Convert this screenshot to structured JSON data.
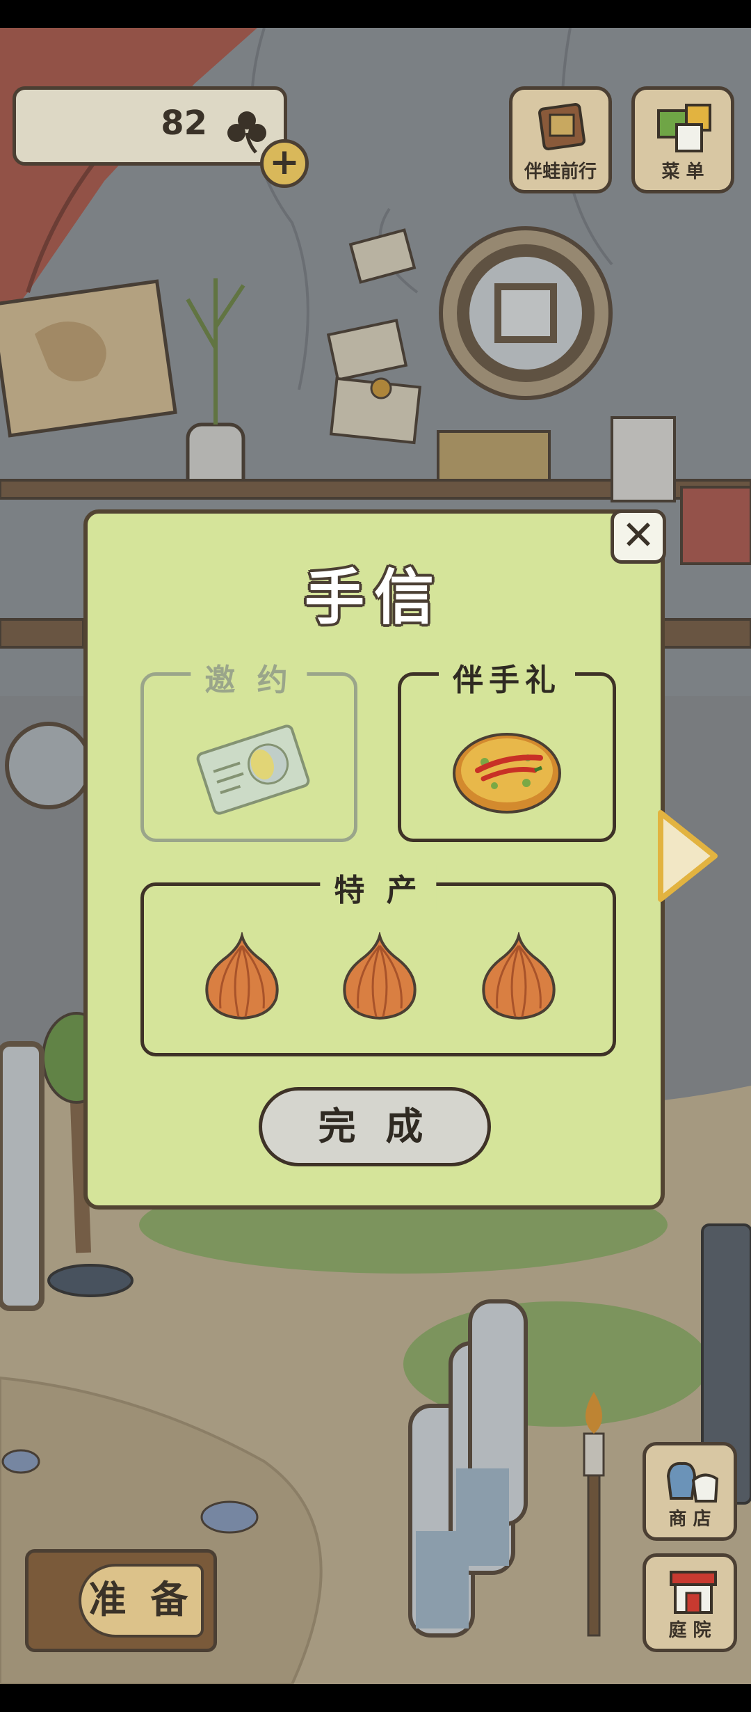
{
  "hud": {
    "clover_count": "82",
    "top_buttons": [
      {
        "label": "伴蛙前行",
        "icon": "book-icon"
      },
      {
        "label": "菜 单",
        "icon": "cards-menu-icon"
      }
    ]
  },
  "dialog": {
    "title": "手信",
    "slots": {
      "invite": {
        "label": "邀 约",
        "state": "disabled",
        "icon": "invitation-card-icon"
      },
      "gift": {
        "label": "伴手礼",
        "item": "pancake-with-chili-icon"
      },
      "specialty": {
        "label": "特 产",
        "items": [
          "onion-icon",
          "onion-icon",
          "onion-icon"
        ]
      }
    },
    "done_label": "完 成"
  },
  "bottom": {
    "prepare_label": "准 备",
    "side_buttons": [
      {
        "label": "商 店",
        "icon": "shop-icon"
      },
      {
        "label": "庭 院",
        "icon": "yard-icon"
      }
    ]
  },
  "colors": {
    "dialog_bg": "#d5e49a",
    "outline": "#4b3f33",
    "button_bg": "#d5d5ce"
  }
}
